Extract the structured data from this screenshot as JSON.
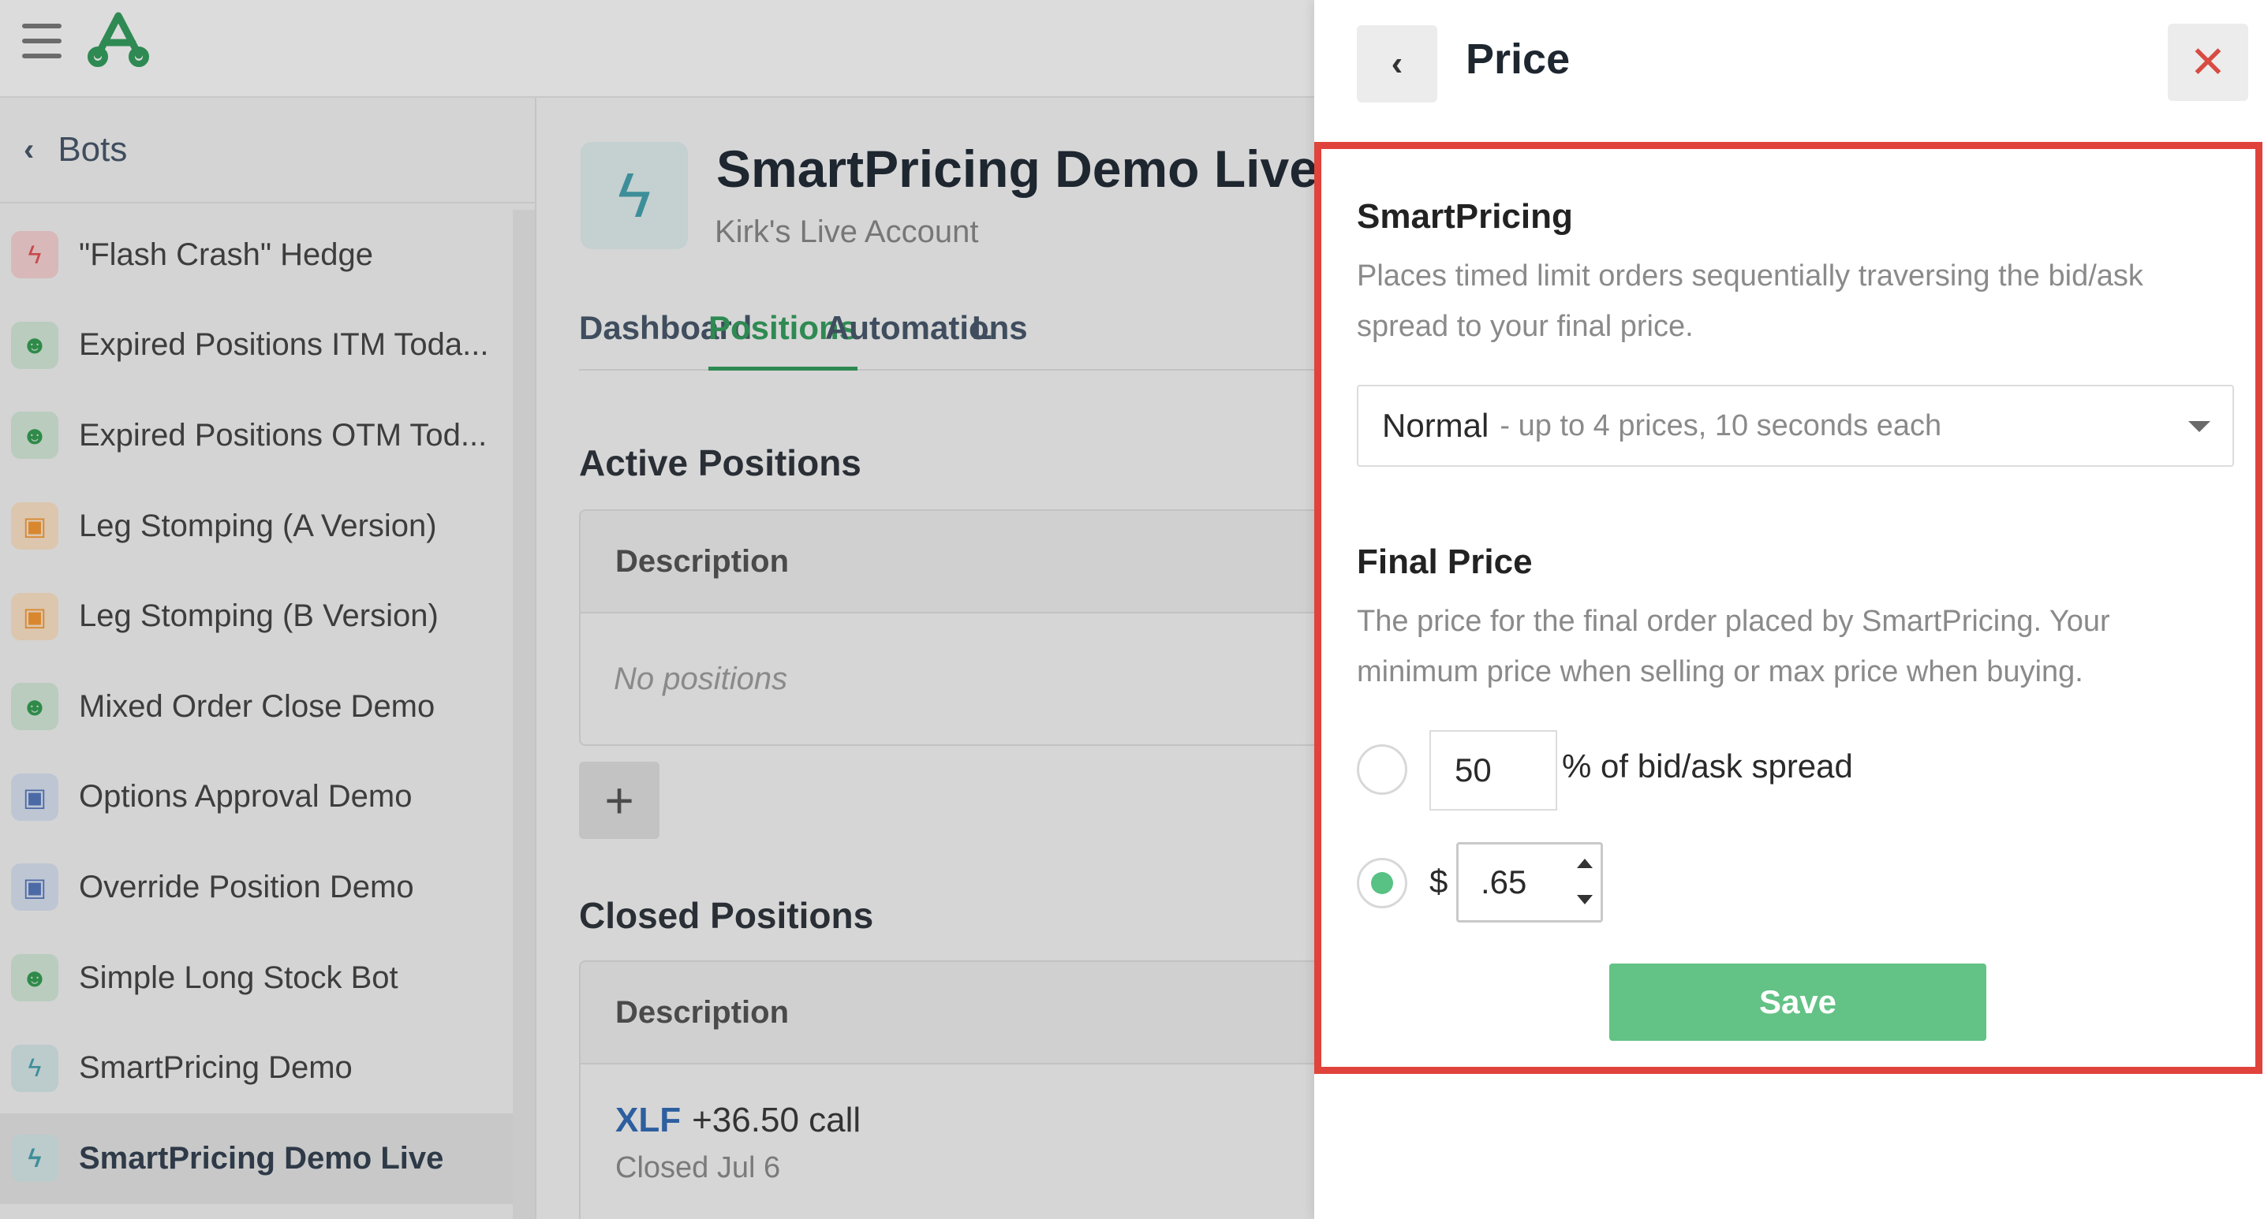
{
  "nav": {
    "back_label": "Bots"
  },
  "sidebar": {
    "items": [
      {
        "label": "\"Flash Crash\" Hedge",
        "icon": "bolt-icon",
        "color": "red"
      },
      {
        "label": "Expired Positions ITM Toda...",
        "icon": "robot-face-icon",
        "color": "green"
      },
      {
        "label": "Expired Positions OTM Tod...",
        "icon": "robot-face-icon",
        "color": "green"
      },
      {
        "label": "Leg Stomping (A Version)",
        "icon": "robot-icon",
        "color": "orange"
      },
      {
        "label": "Leg Stomping (B Version)",
        "icon": "robot-icon",
        "color": "orange"
      },
      {
        "label": "Mixed Order Close Demo",
        "icon": "robot-face-icon",
        "color": "green"
      },
      {
        "label": "Options Approval Demo",
        "icon": "robot-icon",
        "color": "blue"
      },
      {
        "label": "Override Position Demo",
        "icon": "robot-icon",
        "color": "blue"
      },
      {
        "label": "Simple Long Stock Bot",
        "icon": "robot-face-icon",
        "color": "green"
      },
      {
        "label": "SmartPricing Demo",
        "icon": "bolt-icon",
        "color": "teal"
      },
      {
        "label": "SmartPricing Demo Live",
        "icon": "bolt-icon",
        "color": "teal",
        "active": true
      }
    ]
  },
  "bot": {
    "title": "SmartPricing Demo Live",
    "account": "Kirk's Live Account"
  },
  "tabs": [
    "Dashboard",
    "Positions",
    "Automations",
    "L"
  ],
  "active_positions": {
    "heading": "Active Positions",
    "column": "Description",
    "empty_text": "No positions",
    "add_label": "+"
  },
  "closed_positions": {
    "heading": "Closed Positions",
    "column": "Description",
    "rows": [
      {
        "symbol": "XLF",
        "detail": "+36.50 call",
        "date": "Closed Jul 6"
      }
    ]
  },
  "panel": {
    "title": "Price",
    "back_glyph": "‹",
    "close_glyph": "✕",
    "smartpricing": {
      "title": "SmartPricing",
      "description": "Places timed limit orders sequentially traversing the bid/ask spread to your final price.",
      "selected": "Normal",
      "selected_hint": "- up to 4 prices, 10 seconds each"
    },
    "final_price": {
      "title": "Final Price",
      "description": "The price for the final order placed by SmartPricing. Your minimum price when selling or max price when buying.",
      "percent_value": "50",
      "percent_label": "% of bid/ask spread",
      "currency_symbol": "$",
      "amount_value": ".65",
      "selected_option": "amount"
    },
    "save_label": "Save"
  },
  "colors": {
    "accent_green": "#58c184",
    "save_green": "#63c285",
    "highlight_red": "#e0433b",
    "close_red": "#d74b43",
    "link_blue": "#2d5fa0"
  }
}
